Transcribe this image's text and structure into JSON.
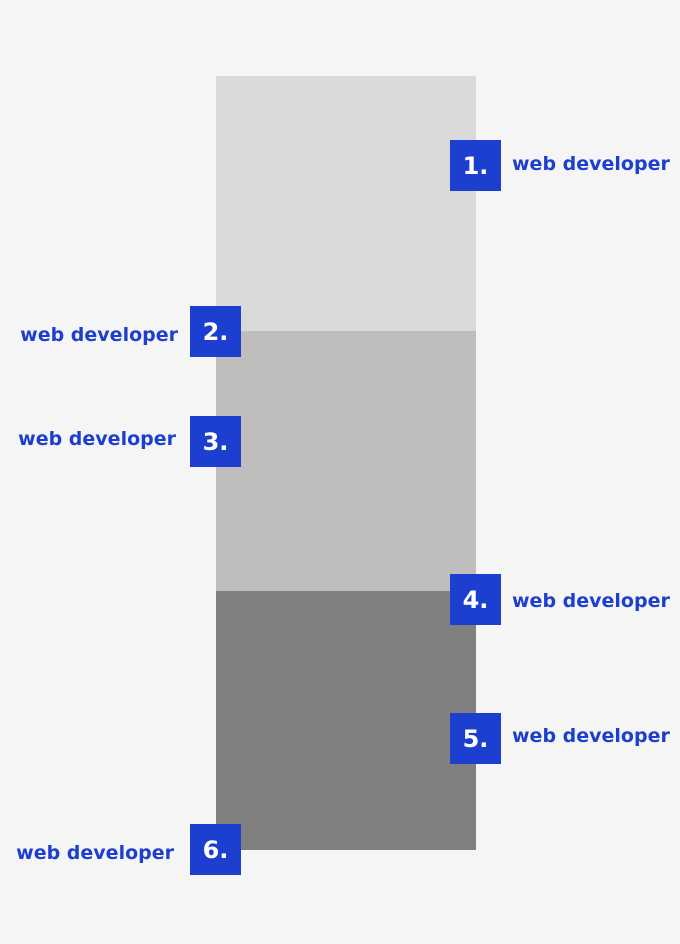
{
  "colors": {
    "background": "#f5f5f5",
    "segment_1": "#d9d9d9",
    "segment_2": "#bfbebc",
    "segment_3": "#808080",
    "accent": "#1c3fd0"
  },
  "markers": [
    {
      "number": "1.",
      "label": "web developer",
      "side": "right"
    },
    {
      "number": "2.",
      "label": "web developer",
      "side": "left"
    },
    {
      "number": "3.",
      "label": "web developer",
      "side": "left"
    },
    {
      "number": "4.",
      "label": "web developer",
      "side": "right"
    },
    {
      "number": "5.",
      "label": "web developer",
      "side": "right"
    },
    {
      "number": "6.",
      "label": "web developer",
      "side": "left"
    }
  ]
}
